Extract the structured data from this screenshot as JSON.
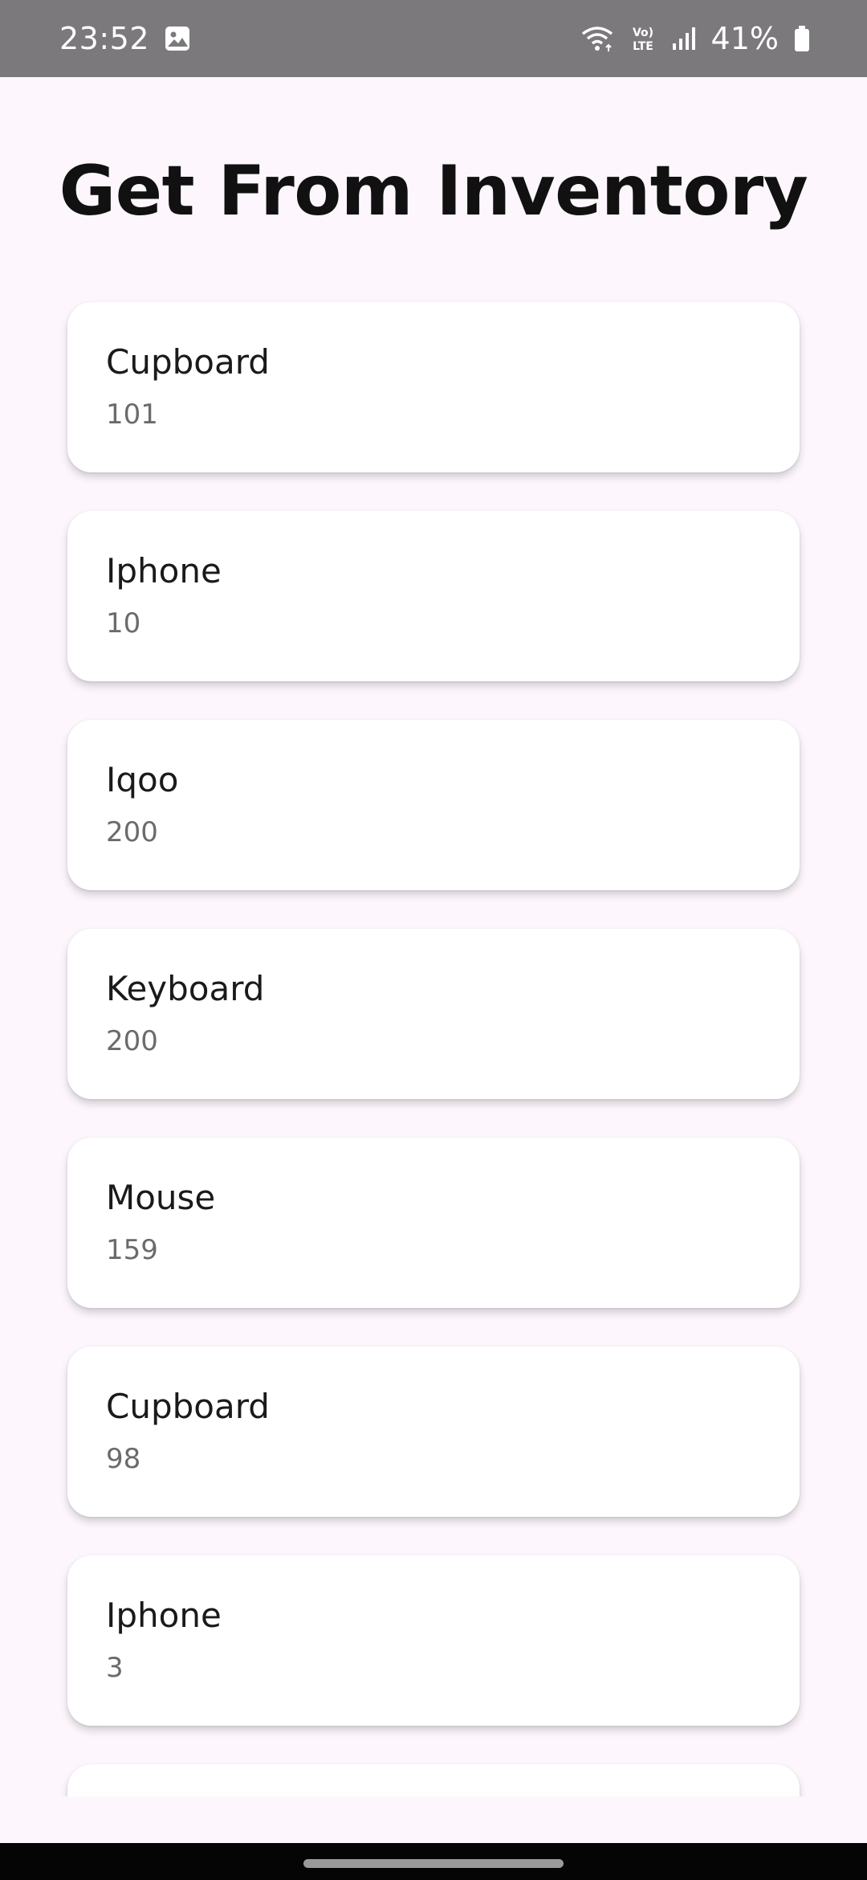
{
  "status_bar": {
    "time": "23:52",
    "battery_percent": "41%",
    "network_label": "Vo) LTE",
    "icons": [
      "image-icon",
      "wifi-icon",
      "volte-icon",
      "signal-icon",
      "battery-icon"
    ]
  },
  "page": {
    "title": "Get From Inventory"
  },
  "items": [
    {
      "name": "Cupboard",
      "quantity": "101"
    },
    {
      "name": "Iphone",
      "quantity": "10"
    },
    {
      "name": "Iqoo",
      "quantity": "200"
    },
    {
      "name": "Keyboard",
      "quantity": "200"
    },
    {
      "name": "Mouse",
      "quantity": "159"
    },
    {
      "name": "Cupboard",
      "quantity": "98"
    },
    {
      "name": "Iphone",
      "quantity": "3"
    },
    {
      "name": "",
      "quantity": ""
    }
  ],
  "colors": {
    "status_bar_bg": "#7c797c",
    "page_bg": "#fdf7fd",
    "card_bg": "#ffffff",
    "nav_bar_bg": "#050505"
  }
}
